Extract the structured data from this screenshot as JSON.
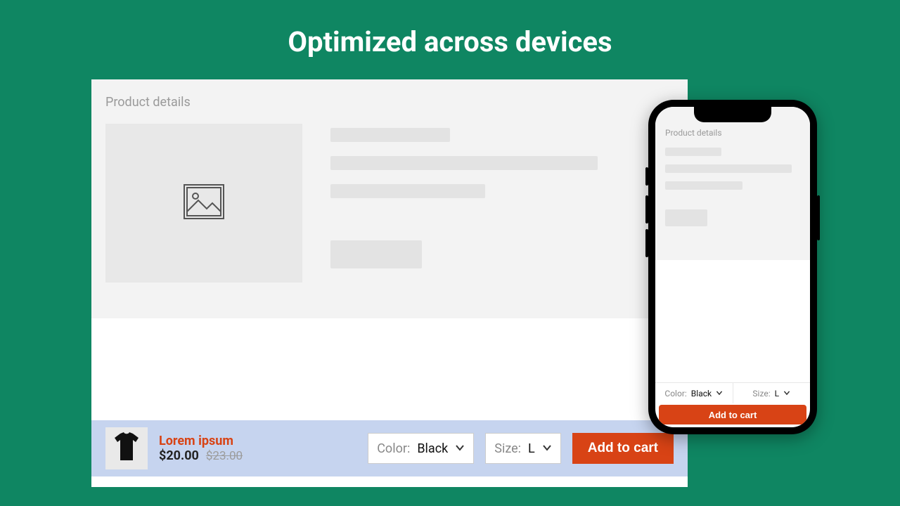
{
  "heading": "Optimized across devices",
  "desktop": {
    "section_title": "Product details"
  },
  "cart_bar": {
    "product_name": "Lorem ipsum",
    "price": "$20.00",
    "old_price": "$23.00",
    "color_label": "Color:",
    "color_value": "Black",
    "size_label": "Size:",
    "size_value": "L",
    "add_label": "Add to cart"
  },
  "phone": {
    "section_title": "Product details",
    "color_label": "Color:",
    "color_value": "Black",
    "size_label": "Size:",
    "size_value": "L",
    "add_label": "Add to cart"
  },
  "colors": {
    "accent": "#d84315",
    "bg": "#0f8662",
    "cart_bg": "#c6d4ef"
  }
}
